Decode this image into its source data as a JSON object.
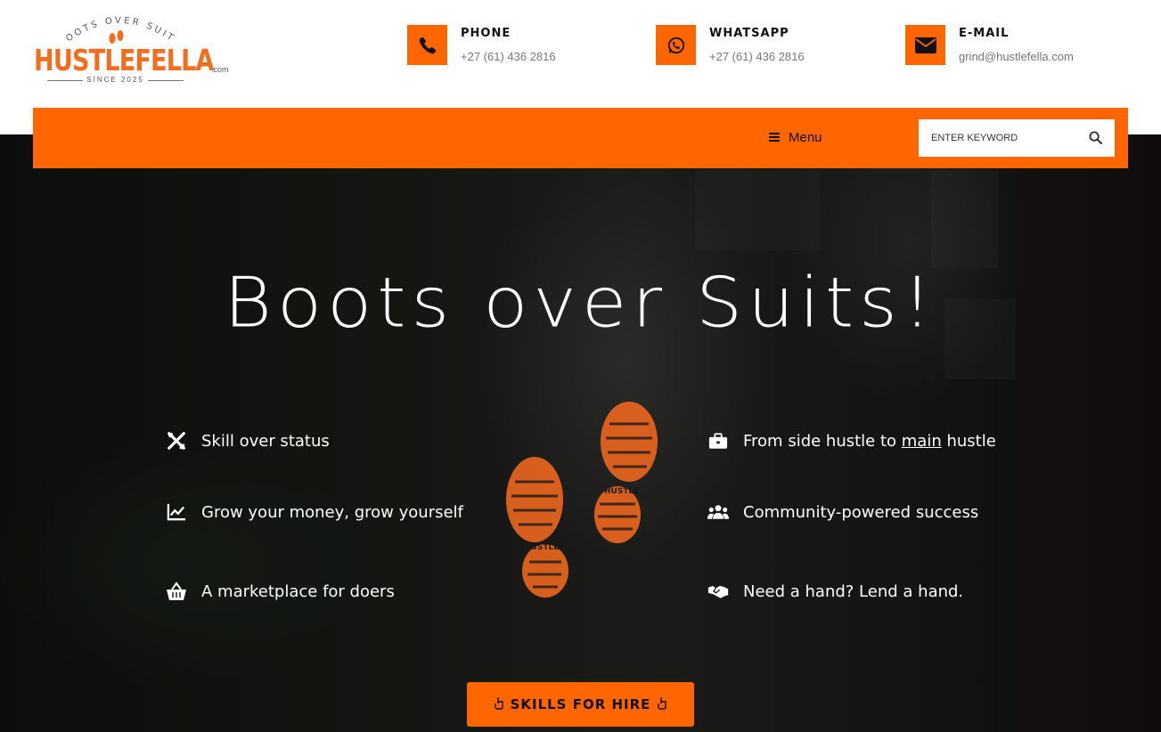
{
  "brand": {
    "arc_text": "BOOTS OVER SUITS",
    "name": "HUSTLEFELLA",
    "tld": ".com",
    "since": "SINCE 2025"
  },
  "contacts": [
    {
      "label": "PHONE",
      "value": "+27 (61) 436 2816",
      "icon": "phone-icon"
    },
    {
      "label": "WHATSAPP",
      "value": "+27 (61) 436 2816",
      "icon": "whatsapp-icon"
    },
    {
      "label": "E-MAIL",
      "value": "grind@hustlefella.com",
      "icon": "envelope-icon"
    }
  ],
  "nav": {
    "menu_label": "Menu",
    "search_placeholder": "ENTER KEYWORD"
  },
  "hero": {
    "headline": "Boots over Suits!",
    "features_left": [
      {
        "text": "Skill over status",
        "icon": "tools-icon"
      },
      {
        "text": "Grow your money, grow yourself",
        "icon": "chart-line-icon"
      },
      {
        "text": "A marketplace for doers",
        "icon": "basket-icon"
      }
    ],
    "features_right": [
      {
        "pre": "From side hustle to ",
        "emph": "main",
        "post": " hustle",
        "icon": "briefcase-icon"
      },
      {
        "text": "Community-powered success",
        "icon": "users-icon"
      },
      {
        "text": "Need a hand? Lend a hand.",
        "icon": "handshake-icon"
      }
    ],
    "boot_label": "HUSTLE",
    "cta_label": "SKILLS FOR HIRE"
  },
  "colors": {
    "accent": "#ff6600",
    "text_dark": "#111111",
    "text_muted": "#777777"
  }
}
